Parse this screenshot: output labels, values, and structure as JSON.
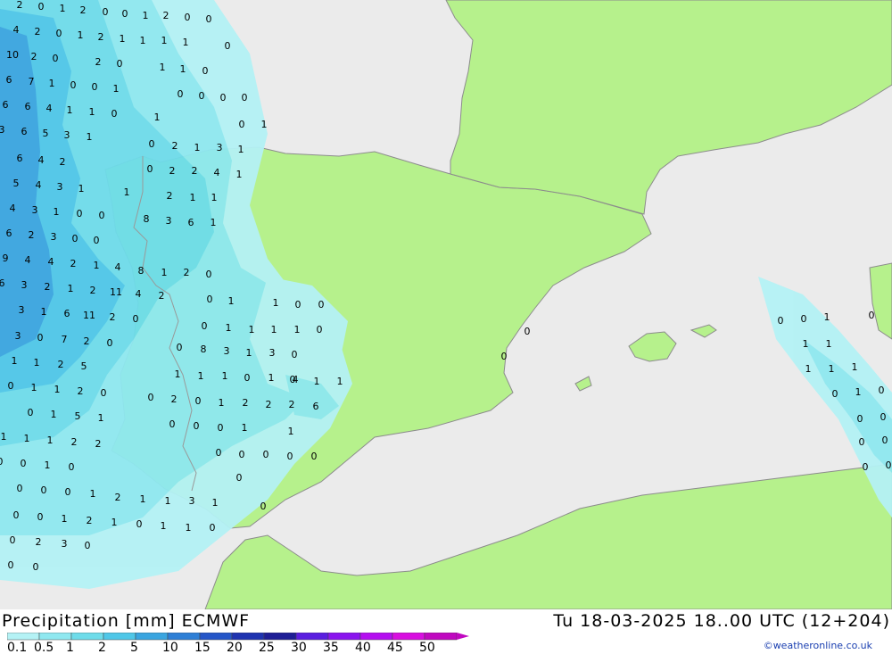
{
  "title": "Precipitation [mm] ECMWF",
  "run": "Tu 18-03-2025 18..00 UTC (12+204)",
  "credit": "©weatheronline.co.uk",
  "colors": {
    "sea": "#ebebeb",
    "land": "#b6f18c",
    "border": "#999999",
    "coast": "#8c8c8c"
  },
  "legend": {
    "labels": [
      "0.1",
      "0.5",
      "1",
      "2",
      "5",
      "10",
      "15",
      "20",
      "25",
      "30",
      "35",
      "40",
      "45",
      "50"
    ],
    "colors": [
      "#b4f2f5",
      "#8fe8f0",
      "#6edcea",
      "#4fc7e8",
      "#3aa5e0",
      "#2e7fd6",
      "#2556c8",
      "#1e33b0",
      "#1e1e96",
      "#5a1ee0",
      "#8a14ee",
      "#b40ef0",
      "#d80ee0",
      "#c008c0"
    ]
  },
  "values": [
    "2",
    "0",
    "1",
    "2",
    "0",
    "0",
    "1",
    "2",
    "0",
    "0",
    "4",
    "2",
    "0",
    "1",
    "2",
    "1",
    "1",
    "1",
    "1",
    "0",
    "10",
    "2",
    "0",
    "2",
    "0",
    "1",
    "1",
    "0",
    "6",
    "7",
    "1",
    "0",
    "0",
    "1",
    "0",
    "0",
    "0",
    "0",
    "6",
    "6",
    "4",
    "1",
    "1",
    "0",
    "1",
    "3",
    "6",
    "5",
    "3",
    "1",
    "0",
    "1",
    "6",
    "4",
    "2",
    "0",
    "2",
    "1",
    "3",
    "1",
    "5",
    "4",
    "3",
    "1",
    "0",
    "2",
    "2",
    "4",
    "1",
    "4",
    "3",
    "1",
    "0",
    "0",
    "1",
    "2",
    "1",
    "1",
    "6",
    "2",
    "3",
    "0",
    "0",
    "8",
    "3",
    "6",
    "1",
    "9",
    "4",
    "4",
    "2",
    "1",
    "4",
    "8",
    "1",
    "2",
    "0",
    "6",
    "3",
    "2",
    "1",
    "2",
    "11",
    "4",
    "2",
    "0",
    "1",
    "3",
    "1",
    "6",
    "11",
    "2",
    "0",
    "1",
    "0",
    "0",
    "3",
    "0",
    "7",
    "2",
    "0",
    "0",
    "1",
    "1",
    "1",
    "1",
    "0",
    "1",
    "1",
    "2",
    "5",
    "0",
    "8",
    "3",
    "1",
    "3",
    "0",
    "0",
    "1",
    "1",
    "2",
    "0",
    "1",
    "1",
    "1",
    "0",
    "1",
    "0",
    "4",
    "1",
    "1",
    "0",
    "1",
    "5",
    "1",
    "0",
    "2",
    "0",
    "1",
    "2",
    "2",
    "2",
    "6",
    "1",
    "1",
    "1",
    "2",
    "2",
    "0",
    "0",
    "0",
    "1",
    "1",
    "0",
    "0",
    "1",
    "0",
    "0",
    "0",
    "0",
    "0",
    "0",
    "0",
    "0",
    "0",
    "1",
    "2",
    "1",
    "1",
    "3",
    "1",
    "0",
    "0",
    "0",
    "1",
    "2",
    "1",
    "0",
    "1",
    "1",
    "0",
    "0",
    "2",
    "3",
    "0",
    "0",
    "0",
    "0",
    "0",
    "0",
    "0",
    "0",
    "1",
    "0",
    "1",
    "1",
    "1",
    "1",
    "1",
    "0",
    "1",
    "0",
    "0",
    "0",
    "0",
    "0",
    "0",
    "0"
  ]
}
